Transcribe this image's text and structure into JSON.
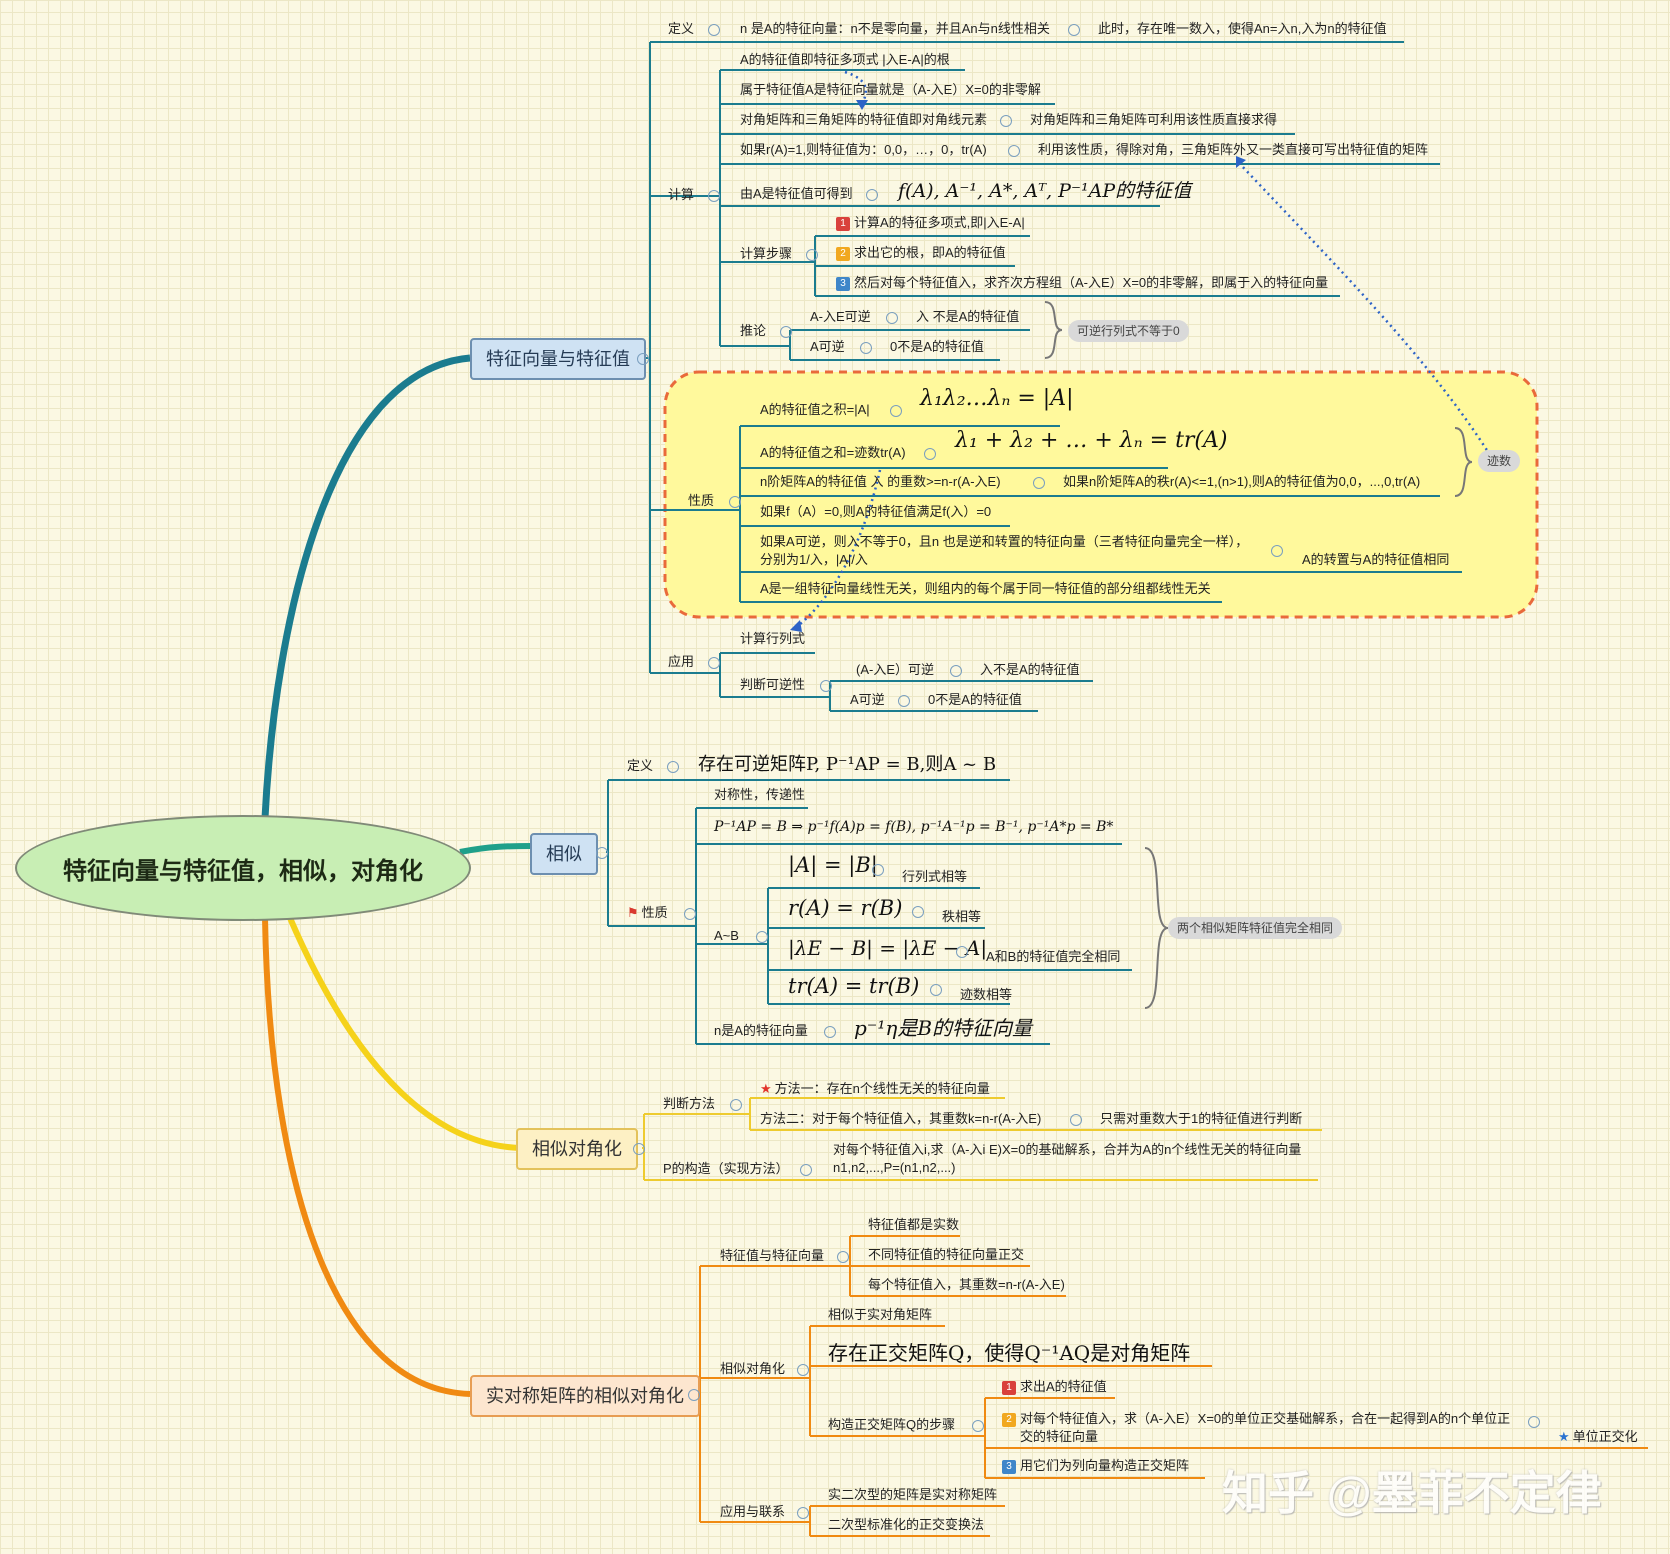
{
  "root": "特征向量与特征值，相似，对角化",
  "eig": {
    "title": "特征向量与特征值",
    "def_label": "定义",
    "def_text": "n 是A的特征向量：n不是零向量，并且An与n线性相关",
    "def_extra": "此时，存在唯一数入，使得An=入n,入为n的特征值",
    "calc_label": "计算",
    "calc": [
      "A的特征值即特征多项式 |入E-A|的根",
      "属于特征值A是特征向量就是（A-入E）X=0的非零解",
      "对角矩阵和三角矩阵的特征值即对角线元素",
      "对角矩阵和三角矩阵可利用该性质直接求得",
      "如果r(A)=1,则特征值为：0,0，…，0，tr(A)",
      "利用该性质，得除对角，三角矩阵外又一类直接可写出特征值的矩阵",
      "由A是特征值可得到",
      "f(A), A⁻¹, A*, Aᵀ, P⁻¹AP的特征值"
    ],
    "steps_label": "计算步骤",
    "steps": [
      "计算A的特征多项式,即|入E-A|",
      "求出它的根，即A的特征值",
      "然后对每个特征值入，求齐次方程组（A-入E）X=0的非零解，即属于入的特征向量"
    ],
    "step_nums": [
      "1",
      "2",
      "3"
    ],
    "infer_label": "推论",
    "infer": [
      "A-入E可逆",
      "入 不是A的特征值",
      "A可逆",
      "0不是A的特征值"
    ],
    "infer_note": "可逆行列式不等于0",
    "prop_label": "性质",
    "props": [
      "A的特征值之积=|A|",
      "λ₁λ₂…λₙ = |A|",
      "A的特征值之和=迹数tr(A)",
      "λ₁ + λ₂ + … + λₙ = tr(A)",
      "n阶矩阵A的特征值 入 的重数>=n-r(A-入E)",
      "如果n阶矩阵A的秩r(A)<=1,(n>1),则A的特征值为0,0，...,0,tr(A)",
      "如果f（A）=0,则A的特征值满足f(入）=0",
      "如果A可逆，则入不等于0，且n 也是逆和转置的特征向量（三者特征向量完全一样），",
      "分别为1/入，|A|/入",
      "A的转置与A的特征值相同",
      "A是一组特征向量线性无关，则组内的每个属于同一特征值的部分组都线性无关"
    ],
    "trace_note": "迹数",
    "app_label": "应用",
    "app": [
      "计算行列式",
      "判断可逆性",
      "(A-入E）可逆",
      "入不是A的特征值",
      "A可逆",
      "0不是A的特征值"
    ]
  },
  "sim": {
    "title": "相似",
    "def_label": "定义",
    "def_formula": "存在可逆矩阵P, P⁻¹AP = B,则A ~ B",
    "prop_label": "性质",
    "props": [
      "对称性，传递性",
      "P⁻¹AP = B ⇒ p⁻¹f(A)p = f(B), p⁻¹A⁻¹p = B⁻¹, p⁻¹A*p = B*"
    ],
    "ab_label": "A~B",
    "ab": [
      {
        "formula": "|A| = |B|",
        "note": "行列式相等"
      },
      {
        "formula": "r(A) = r(B)",
        "note": "秩相等"
      },
      {
        "formula": "|λE − B| = |λE − A|",
        "note": "A和B的特征值完全相同"
      },
      {
        "formula": "tr(A) = tr(B)",
        "note": "迹数相等"
      }
    ],
    "ab_note": "两个相似矩阵特征值完全相同",
    "evec_label": "n是A的特征向量",
    "evec_formula": "p⁻¹η是B的特征向量"
  },
  "diag": {
    "title": "相似对角化",
    "judge_label": "判断方法",
    "method1": "方法一：存在n个线性无关的特征向量",
    "method2": "方法二：对于每个特征值入，其重数k=n-r(A-入E)",
    "method2_note": "只需对重数大于1的特征值进行判断",
    "p_label": "P的构造（实现方法）",
    "p_text1": "对每个特征值入i,求（A-入i E)X=0的基础解系，合并为A的n个线性无关的特征向量",
    "p_text2": "n1,n2,...,P=(n1,n2,...)"
  },
  "sym": {
    "title": "实对称矩阵的相似对角化",
    "ev_label": "特征值与特征向量",
    "ev": [
      "特征值都是实数",
      "不同特征值的特征向量正交",
      "每个特征值入，其重数=n-r(A-入E)"
    ],
    "sd_label": "相似对角化",
    "sd": [
      "相似于实对角矩阵",
      "存在正交矩阵Q，使得Q⁻¹AQ是对角矩阵"
    ],
    "steps_label": "构造正交矩阵Q的步骤",
    "steps": [
      "求出A的特征值",
      "对每个特征值入，求（A-入E）X=0的单位正交基础解系，合在一起得到A的n个单位正",
      "交的特征向量",
      "用它们为列向量构造正交矩阵"
    ],
    "step_nums": [
      "1",
      "2",
      "3"
    ],
    "unit_note": "单位正交化",
    "app_label": "应用与联系",
    "app": [
      "实二次型的矩阵是实对称矩阵",
      "二次型标准化的正交变换法"
    ]
  },
  "watermark": "知乎 @墨菲不定律",
  "colors": {
    "teal": "#1b7c8f",
    "orange": "#f08a12",
    "yellow": "#f5d21a",
    "dashed": "#e96a3b",
    "pill": "#d9d9d9"
  }
}
